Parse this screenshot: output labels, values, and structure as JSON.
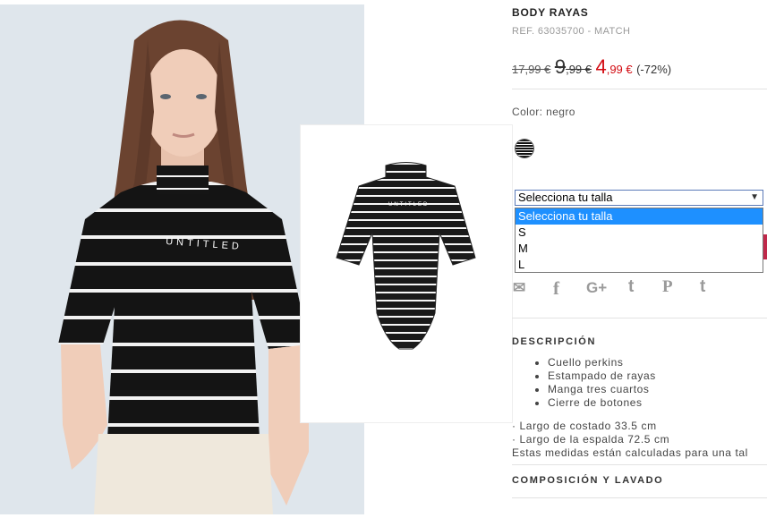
{
  "product": {
    "title": "BODY RAYAS",
    "ref": "REF. 63035700 - MATCH",
    "price_original": "17,99 €",
    "price_prev_int": "9",
    "price_prev_dec": ",99 €",
    "price_new_int": "4",
    "price_new_dec": ",99 €",
    "discount": "(-72%)"
  },
  "color": {
    "label": "Color: negro",
    "swatch_color": "#111111"
  },
  "size_select": {
    "value": "Selecciona tu talla",
    "options": [
      "Selecciona tu talla",
      "S",
      "M",
      "L"
    ],
    "selected_index": 0
  },
  "share": {
    "icons": [
      "email-icon",
      "facebook-icon",
      "google-plus-icon",
      "twitter-icon",
      "pinterest-icon",
      "tumblr-icon"
    ],
    "glyphs": [
      "✉",
      "f",
      "G+",
      "t",
      "P",
      "t"
    ]
  },
  "description": {
    "heading": "DESCRIPCIÓN",
    "bullets": [
      "Cuello perkins",
      "Estampado de rayas",
      "Manga tres cuartos",
      "Cierre de botones"
    ],
    "measures": [
      "· Largo de costado 33.5 cm",
      "· Largo de la espalda 72.5 cm",
      "Estas medidas están calculadas para una tal"
    ]
  },
  "composition": {
    "heading": "COMPOSICIÓN Y LAVADO"
  },
  "garment_print": "UNTITLED"
}
